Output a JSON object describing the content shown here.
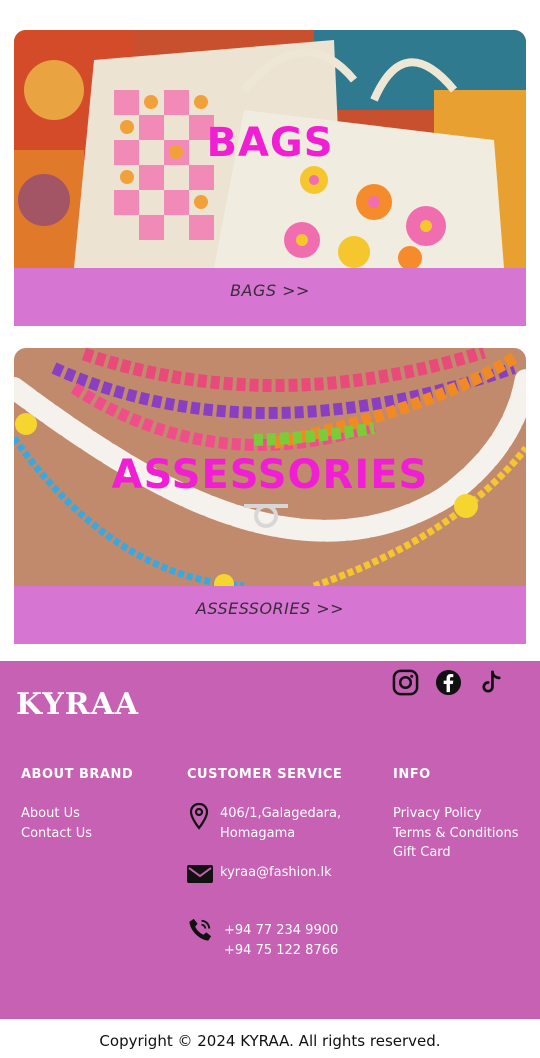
{
  "cards": [
    {
      "title": "BAGS",
      "button_label": "BAGS >>",
      "image": "tote-bags-photo"
    },
    {
      "title": "ASSESSORIES",
      "button_label": "ASSESSORIES >>",
      "image": "beaded-necklaces-photo"
    }
  ],
  "footer": {
    "brand": "KYRAA",
    "social_icons": [
      "instagram-icon",
      "facebook-icon",
      "tiktok-icon"
    ],
    "about": {
      "heading": "ABOUT BRAND",
      "links": [
        "About Us",
        "Contact Us"
      ]
    },
    "service": {
      "heading": "CUSTOMER SERVICE",
      "address": [
        "406/1,Galagedara,",
        "Homagama"
      ],
      "email": "kyraa@fashion.lk",
      "phones": [
        "+94 77 234 9900",
        "+94 75 122 8766"
      ]
    },
    "info": {
      "heading": "INFO",
      "links": [
        "Privacy Policy",
        "Terms & Conditions",
        "Gift Card"
      ]
    }
  },
  "copyright": "Copyright © 2024 KYRAA. All rights reserved.",
  "colors": {
    "accent": "#d776d2",
    "footer_bg": "#c661b3",
    "title_pink": "#f01fd4"
  }
}
